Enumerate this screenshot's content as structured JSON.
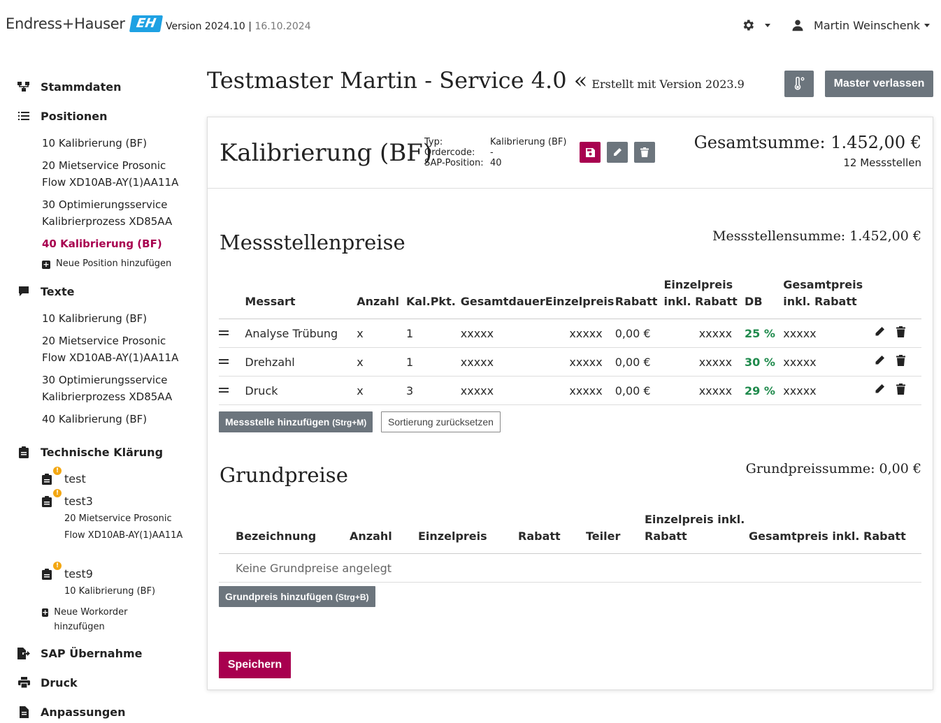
{
  "header": {
    "brand_name": "Endress+Hauser",
    "brand_mark": "EH",
    "version_label": "Version 2024.10",
    "version_sep": " | ",
    "version_date": "16.10.2024",
    "user_name": "Martin Weinschenk",
    "accent_color": "#1ea1e3"
  },
  "sidebar": {
    "stammdaten": "Stammdaten",
    "positionen": "Positionen",
    "positionen_items": [
      "10 Kalibrierung (BF)",
      "20 Mietservice Prosonic Flow XD10AB-AY(1)AA11A",
      "30 Optimierungsservice Kalibrierprozess XD85AA",
      "40 Kalibrierung (BF)"
    ],
    "neue_position": "Neue Position hinzufügen",
    "texte": "Texte",
    "texte_items": [
      "10 Kalibrierung (BF)",
      "20 Mietservice Prosonic Flow XD10AB-AY(1)AA11A",
      "30 Optimierungsservice Kalibrierprozess XD85AA",
      "40 Kalibrierung (BF)"
    ],
    "technische_klaerung": "Technische Klärung",
    "workorders": [
      {
        "name": "test",
        "sub": ""
      },
      {
        "name": "test3",
        "sub": "20 Mietservice Prosonic Flow XD10AB-AY(1)AA11A"
      },
      {
        "name": "test9",
        "sub": "10 Kalibrierung (BF)"
      }
    ],
    "badge": "!",
    "neue_workorder": "Neue Workorder hinzufügen",
    "sap": "SAP Übernahme",
    "druck": "Druck",
    "anpassungen": "Anpassungen",
    "active_color": "#a8004f"
  },
  "main": {
    "title": "Testmaster Martin - Service 4.0 «",
    "title_sub": "Erstellt mit Version 2023.9",
    "leave_button": "Master verlassen",
    "position_title": "Kalibrierung (BF)",
    "meta_labels": [
      "Typ:",
      "Ordercode:",
      "SAP-Position:"
    ],
    "meta_values": [
      "Kalibrierung (BF)",
      "-",
      "40"
    ],
    "total_label": "Gesamtsumme: 1.452,00 €",
    "total_sub": "12 Messstellen",
    "mess_title": "Messstellenpreise",
    "mess_sum": "Messstellensumme: 1.452,00 €",
    "mess_headers": [
      "Messart",
      "Anzahl",
      "Kal.Pkt.",
      "Gesamtdauer",
      "Einzelpreis",
      "Rabatt",
      "Einzelpreis inkl. Rabatt",
      "DB",
      "Gesamtpreis inkl. Rabatt"
    ],
    "mess_rows": [
      [
        "Analyse Trübung",
        "x",
        "1",
        "xxxxx",
        "xxxxx",
        "0,00 €",
        "xxxxx",
        "25 %",
        "xxxxx"
      ],
      [
        "Drehzahl",
        "x",
        "1",
        "xxxxx",
        "xxxxx",
        "0,00 €",
        "xxxxx",
        "30 %",
        "xxxxx"
      ],
      [
        "Druck",
        "x",
        "3",
        "xxxxx",
        "xxxxx",
        "0,00 €",
        "xxxxx",
        "29 %",
        "xxxxx"
      ]
    ],
    "add_messstelle": "Messstelle hinzufügen",
    "add_messstelle_hint": "(Strg+M)",
    "reset_sort": "Sortierung zurücksetzen",
    "grund_title": "Grundpreise",
    "grund_sum": "Grundpreissumme: 0,00 €",
    "grund_headers": [
      "Bezeichnung",
      "Anzahl",
      "Einzelpreis",
      "Rabatt",
      "Teiler",
      "Einzelpreis inkl. Rabatt",
      "Gesamtpreis inkl. Rabatt"
    ],
    "grund_empty": "Keine Grundpreise angelegt",
    "add_grund": "Grundpreis hinzufügen",
    "add_grund_hint": "(Strg+B)",
    "save": "Speichern",
    "save_color": "#a8004f",
    "db_color": "#1f8a4c"
  }
}
